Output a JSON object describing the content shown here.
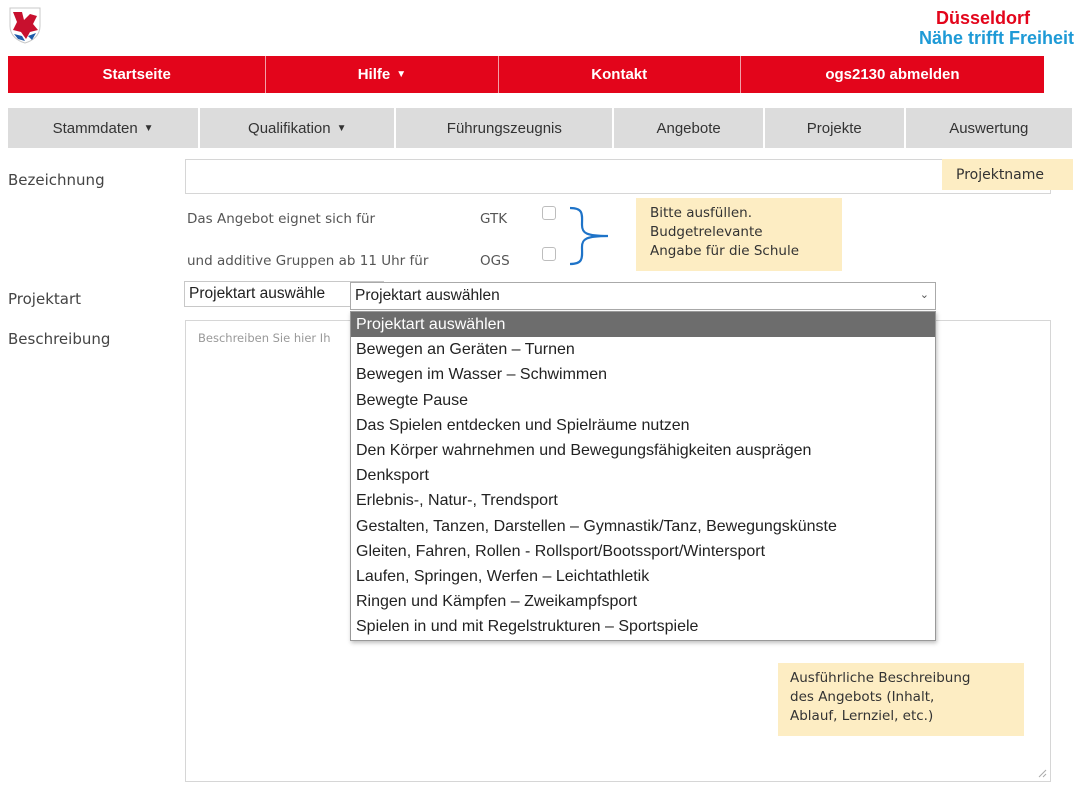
{
  "brand": {
    "line1": "Düsseldorf",
    "line2": "Nähe trifft Freiheit",
    "red": "#e3051b",
    "blue": "#1e9ad6"
  },
  "topnav": [
    {
      "label": "Startseite",
      "caret": false
    },
    {
      "label": "Hilfe",
      "caret": true
    },
    {
      "label": "Kontakt",
      "caret": false
    },
    {
      "label": "ogs2130 abmelden",
      "caret": false
    }
  ],
  "subnav": [
    {
      "label": "Stammdaten",
      "caret": true
    },
    {
      "label": "Qualifikation",
      "caret": true
    },
    {
      "label": "Führungszeugnis",
      "caret": false
    },
    {
      "label": "Angebote",
      "caret": false
    },
    {
      "label": "Projekte",
      "caret": false
    },
    {
      "label": "Auswertung",
      "caret": false
    }
  ],
  "form": {
    "bezeichnung_label": "Bezeichnung",
    "bezeichnung_value": "",
    "projektname_tip": "Projektname",
    "eignung_text": "Das Angebot eignet sich für",
    "gtk_label": "GTK",
    "additiv_text": "und additive Gruppen ab 11 Uhr für",
    "ogs_label": "OGS",
    "budget_tip": [
      "Bitte ausfüllen.",
      "Budgetrelevante",
      "Angabe für die Schule"
    ],
    "projektart_label": "Projektart",
    "projektart_value_back": "Projektart auswähle",
    "projektart_value": "Projektart auswählen",
    "beschreibung_label": "Beschreibung",
    "beschreibung_placeholder": "Beschreiben Sie hier Ih",
    "beschreibung_tip": [
      "Ausführliche Beschreibung",
      "des Angebots (Inhalt,",
      "Ablauf, Lernziel, etc.)"
    ]
  },
  "projektart_options": [
    "Projektart auswählen",
    "Bewegen an Geräten – Turnen",
    "Bewegen im Wasser – Schwimmen",
    "Bewegte Pause",
    "Das Spielen entdecken und Spielräume nutzen",
    "Den Körper wahrnehmen und Bewegungsfähigkeiten ausprägen",
    "Denksport",
    "Erlebnis-, Natur-, Trendsport",
    "Gestalten, Tanzen, Darstellen – Gymnastik/Tanz, Bewegungskünste",
    "Gleiten, Fahren, Rollen - Rollsport/Bootssport/Wintersport",
    "Laufen, Springen, Werfen – Leichtathletik",
    "Ringen und Kämpfen – Zweikampfsport",
    "Spielen in und mit Regelstrukturen – Sportspiele"
  ],
  "selected_option_index": 0,
  "icons": {
    "crest": "duesseldorf-crest-icon",
    "caret": "caret-down-icon",
    "chevron": "chevron-down-icon",
    "brace": "curly-brace-icon",
    "resize": "resize-handle-icon"
  }
}
